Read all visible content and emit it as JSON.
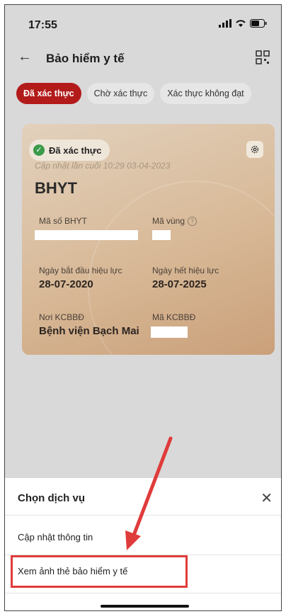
{
  "status_bar": {
    "time": "17:55"
  },
  "header": {
    "title": "Bảo hiểm y tế"
  },
  "tabs": [
    {
      "label": "Đã xác thực",
      "active": true
    },
    {
      "label": "Chờ xác thực",
      "active": false
    },
    {
      "label": "Xác thực không đạt",
      "active": false
    }
  ],
  "card": {
    "status_badge": "Đã xác thực",
    "updated": "Cập nhật lần cuối 10:29 03-04-2023",
    "type": "BHYT",
    "fields": {
      "ma_so_label": "Mã số BHYT",
      "ma_vung_label": "Mã vùng",
      "start_label": "Ngày bắt đầu hiệu lực",
      "start_value": "28-07-2020",
      "end_label": "Ngày hết hiệu lực",
      "end_value": "28-07-2025",
      "kcb_label": "Nơi KCBBĐ",
      "kcb_value": "Bệnh viện Bạch Mai",
      "ma_kcb_label": "Mã KCBBĐ"
    }
  },
  "sheet": {
    "title": "Chọn dịch vụ",
    "options": [
      {
        "label": "Cập nhật thông tin"
      },
      {
        "label": "Xem ảnh thẻ bảo hiểm y tế",
        "highlighted": true
      }
    ]
  },
  "colors": {
    "accent": "#b31b1b",
    "annotation": "#e03b3b"
  }
}
